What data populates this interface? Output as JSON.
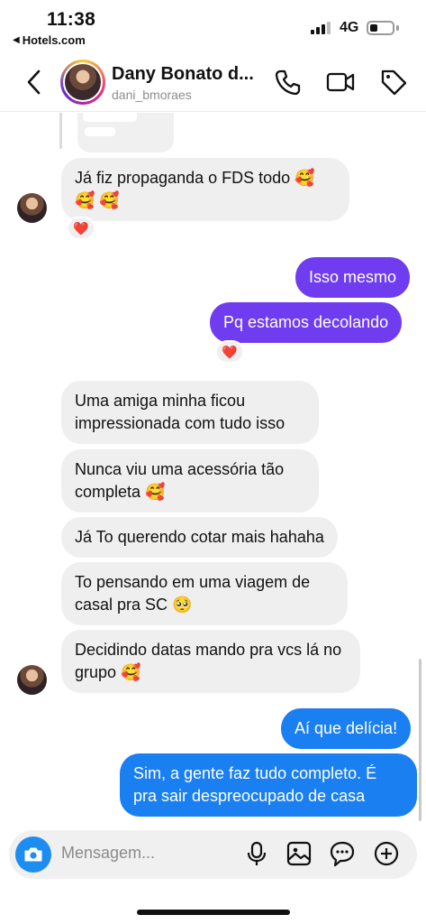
{
  "status_bar": {
    "time": "11:38",
    "back_app": "Hotels.com",
    "network": "4G"
  },
  "header": {
    "name": "Dany Bonato d...",
    "username": "dani_bmoraes"
  },
  "messages": [
    {
      "id": "m1",
      "sender": "them",
      "text": "Já fiz propaganda o FDS todo 🥰 🥰 🥰",
      "reaction": "❤️"
    },
    {
      "id": "m2",
      "sender": "me",
      "text": "Isso mesmo"
    },
    {
      "id": "m3",
      "sender": "me",
      "text": "Pq estamos decolando",
      "reaction": "❤️"
    },
    {
      "id": "m4",
      "sender": "them",
      "text": "Uma amiga minha ficou impressionada com tudo isso"
    },
    {
      "id": "m5",
      "sender": "them",
      "text": "Nunca viu uma acessória tão completa 🥰"
    },
    {
      "id": "m6",
      "sender": "them",
      "text": "Já To querendo cotar mais hahaha"
    },
    {
      "id": "m7",
      "sender": "them",
      "text": "To pensando em uma viagem de casal pra SC 🥺"
    },
    {
      "id": "m8",
      "sender": "them",
      "text": "Decidindo datas mando pra vcs lá no grupo 🥰"
    },
    {
      "id": "m9",
      "sender": "me",
      "text": "Aí que delícia!"
    },
    {
      "id": "m10",
      "sender": "me",
      "text": "Sim, a gente faz tudo completo. É pra sair despreocupado de casa"
    }
  ],
  "composer": {
    "placeholder": "Mensagem..."
  },
  "colors": {
    "outgoing_purple": "#6f3cf0",
    "outgoing_blue": "#1a7ff0",
    "incoming": "#efefef",
    "camera_button": "#1d8df2"
  }
}
